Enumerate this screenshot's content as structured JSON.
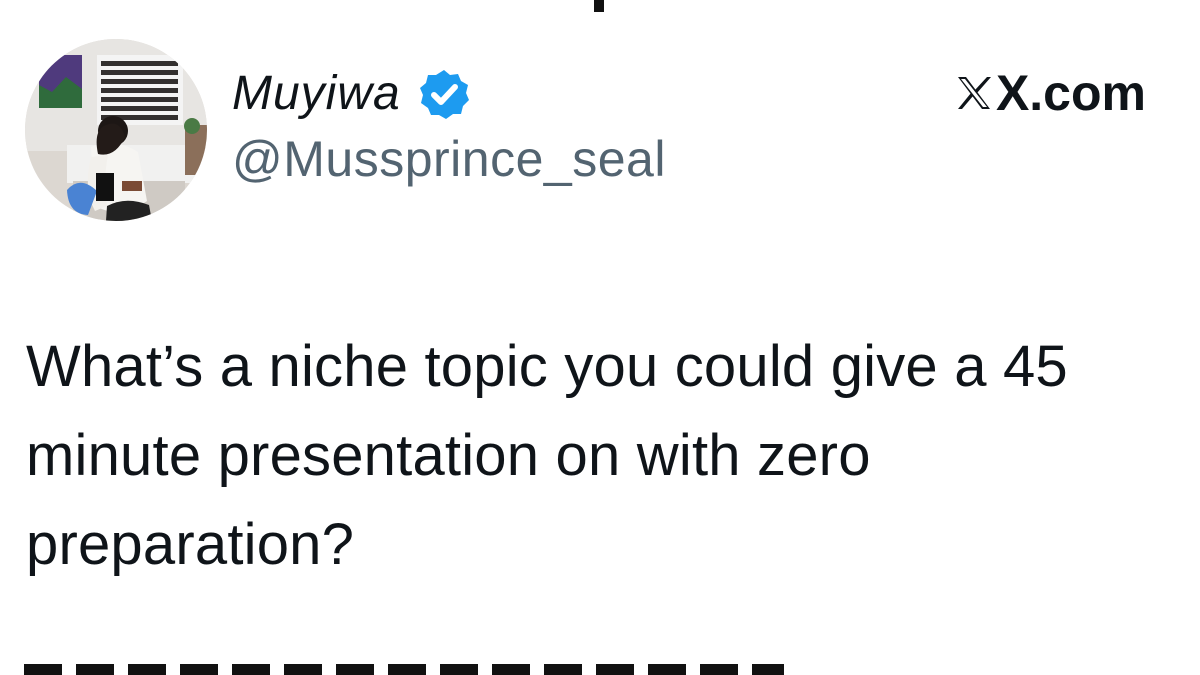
{
  "author": {
    "display_name": "Muyiwa",
    "handle": "@Mussprince_seal",
    "verified": true,
    "avatar": "profile-photo"
  },
  "brand": {
    "label": "X.com",
    "icon": "x-logo-icon"
  },
  "tweet": {
    "text": "What’s a niche topic you could give a 45 minute presentation on with zero preparation?"
  },
  "colors": {
    "text": "#0f1419",
    "secondary": "#536471",
    "verified_blue": "#1d9bf0",
    "background": "#ffffff"
  }
}
